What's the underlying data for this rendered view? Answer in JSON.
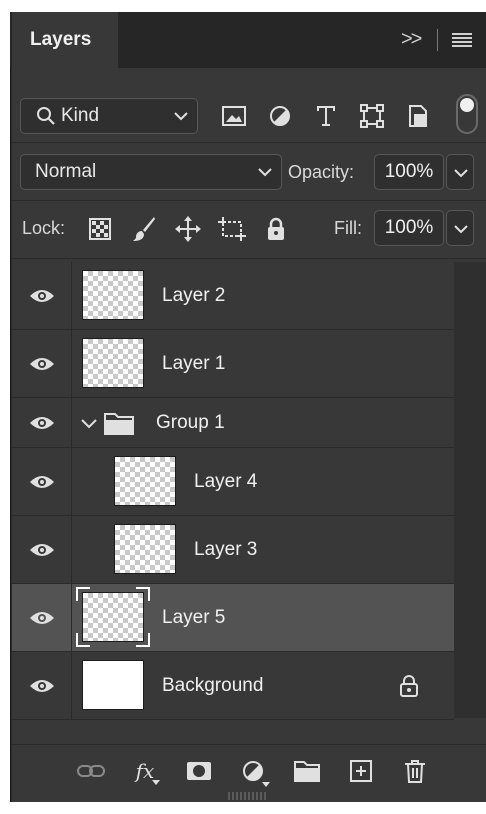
{
  "panel": {
    "tab_title": "Layers",
    "collapse_glyph": ">>"
  },
  "filter": {
    "kind_label": "Kind",
    "icons": [
      "image-filter-icon",
      "adjustment-filter-icon",
      "type-filter-icon",
      "shape-filter-icon",
      "smart-object-filter-icon"
    ],
    "toggle_on": true
  },
  "blend": {
    "mode": "Normal",
    "opacity_label": "Opacity:",
    "opacity_value": "100%"
  },
  "lock": {
    "label": "Lock:",
    "icons": [
      "lock-transparent-pixels-icon",
      "lock-image-pixels-icon",
      "lock-position-icon",
      "lock-artboard-icon",
      "lock-all-icon"
    ],
    "fill_label": "Fill:",
    "fill_value": "100%"
  },
  "layers": [
    {
      "name": "Layer 2",
      "type": "layer",
      "visible": true
    },
    {
      "name": "Layer 1",
      "type": "layer",
      "visible": true
    },
    {
      "name": "Group 1",
      "type": "group",
      "visible": true,
      "expanded": true
    },
    {
      "name": "Layer 4",
      "type": "layer",
      "visible": true,
      "indent": 1
    },
    {
      "name": "Layer 3",
      "type": "layer",
      "visible": true,
      "indent": 1
    },
    {
      "name": "Layer 5",
      "type": "layer",
      "visible": true,
      "selected": true
    },
    {
      "name": "Background",
      "type": "background",
      "visible": true,
      "locked": true
    }
  ],
  "footer": {
    "icons": [
      "link-layers-icon",
      "fx-icon",
      "add-mask-icon",
      "new-adjustment-icon",
      "new-group-icon",
      "new-layer-icon",
      "delete-icon"
    ],
    "fx_text": "fx"
  },
  "colors": {
    "panel_bg": "#383838",
    "selected_row": "#535353",
    "text": "#f0f0f0"
  }
}
